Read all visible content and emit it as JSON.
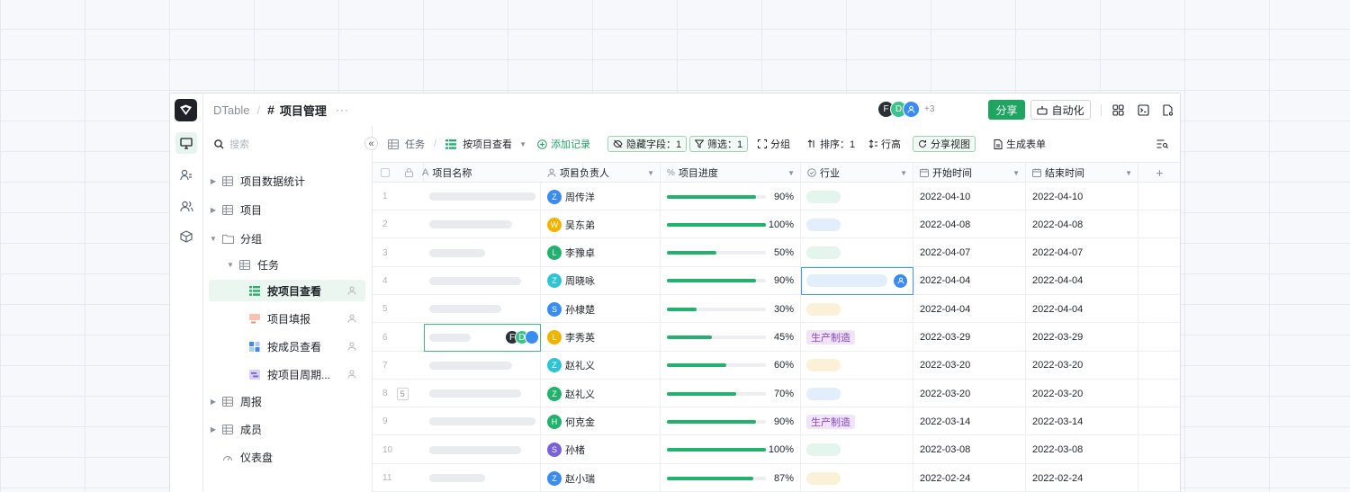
{
  "topbar": {
    "crumb": "DTable",
    "separator": "/",
    "hash": "#",
    "title": "项目管理",
    "more": "···",
    "avatars": [
      {
        "letter": "F",
        "color": "#2b2f36"
      },
      {
        "letter": "D",
        "color": "#3cc38a"
      },
      {
        "letter": "",
        "color": "#3a8cf2"
      }
    ],
    "extra_count": "+3",
    "share_label": "分享",
    "automation_label": "自动化"
  },
  "sidebar": {
    "search_placeholder": "搜索",
    "collapse_glyph": "«",
    "items": [
      {
        "label": "项目数据统计"
      },
      {
        "label": "项目"
      },
      {
        "label": "分组"
      },
      {
        "label": "任务"
      },
      {
        "label": "按项目查看"
      },
      {
        "label": "项目填报"
      },
      {
        "label": "按成员查看"
      },
      {
        "label": "按项目周期..."
      },
      {
        "label": "周报"
      },
      {
        "label": "成员"
      },
      {
        "label": "仪表盘"
      }
    ]
  },
  "viewbar": {
    "table": "任务",
    "slash": "/",
    "view": "按项目查看",
    "add_record": "添加记录",
    "hidden_fields": "隐藏字段：1",
    "filter": "筛选：1",
    "group": "分组",
    "sort": "排序：1",
    "row_height": "行高",
    "share_view": "分享视图",
    "gen_form": "生成表单"
  },
  "columns": [
    "项目名称",
    "项目负责人",
    "项目进度",
    "行业",
    "开始时间",
    "结束时间"
  ],
  "add_column": "+",
  "row_badge": "5",
  "collab_avatars": [
    {
      "letter": "F",
      "color": "#2b2f36"
    },
    {
      "letter": "D",
      "color": "#3cc38a"
    },
    {
      "letter": "",
      "color": "#3a8cf2"
    }
  ],
  "rows": [
    {
      "n": "1",
      "owner_initial": "Z",
      "owner": "周传洋",
      "owner_color": "#3a8cf2",
      "progress": 90,
      "progress_label": "90%",
      "industry": "",
      "industry_color": "#e3f5ec",
      "start": "2022-04-10",
      "end": "2022-04-10"
    },
    {
      "n": "2",
      "owner_initial": "W",
      "owner": "吴东弟",
      "owner_color": "#f0b400",
      "progress": 100,
      "progress_label": "100%",
      "industry": "",
      "industry_color": "#e3eefc",
      "start": "2022-04-08",
      "end": "2022-04-08"
    },
    {
      "n": "3",
      "owner_initial": "L",
      "owner": "李豫卓",
      "owner_color": "#23b26d",
      "progress": 50,
      "progress_label": "50%",
      "industry": "",
      "industry_color": "#e3f5ec",
      "start": "2022-04-07",
      "end": "2022-04-07"
    },
    {
      "n": "4",
      "owner_initial": "Z",
      "owner": "周晓咏",
      "owner_color": "#2ec4d6",
      "progress": 90,
      "progress_label": "90%",
      "industry": "",
      "industry_color": "#e3eefc",
      "start": "2022-04-04",
      "end": "2022-04-04"
    },
    {
      "n": "5",
      "owner_initial": "S",
      "owner": "孙棣楚",
      "owner_color": "#3a8cf2",
      "progress": 30,
      "progress_label": "30%",
      "industry": "",
      "industry_color": "#fbf1d9",
      "start": "2022-04-04",
      "end": "2022-04-04"
    },
    {
      "n": "6",
      "owner_initial": "L",
      "owner": "李秀英",
      "owner_color": "#f0b400",
      "progress": 45,
      "progress_label": "45%",
      "industry": "生产制造",
      "industry_color": "#efe4f8",
      "start": "2022-03-29",
      "end": "2022-03-29"
    },
    {
      "n": "7",
      "owner_initial": "Z",
      "owner": "赵礼义",
      "owner_color": "#2ec4d6",
      "progress": 60,
      "progress_label": "60%",
      "industry": "",
      "industry_color": "#fbf1d9",
      "start": "2022-03-20",
      "end": "2022-03-20"
    },
    {
      "n": "8",
      "owner_initial": "Z",
      "owner": "赵礼义",
      "owner_color": "#23b26d",
      "progress": 70,
      "progress_label": "70%",
      "industry": "",
      "industry_color": "#e3eefc",
      "start": "2022-03-20",
      "end": "2022-03-20"
    },
    {
      "n": "9",
      "owner_initial": "H",
      "owner": "何克金",
      "owner_color": "#23b26d",
      "progress": 90,
      "progress_label": "90%",
      "industry": "生产制造",
      "industry_color": "#efe4f8",
      "start": "2022-03-14",
      "end": "2022-03-14"
    },
    {
      "n": "10",
      "owner_initial": "S",
      "owner": "孙楮",
      "owner_color": "#7b61d9",
      "progress": 100,
      "progress_label": "100%",
      "industry": "",
      "industry_color": "#e3f5ec",
      "start": "2022-03-08",
      "end": "2022-03-08"
    },
    {
      "n": "11",
      "owner_initial": "Z",
      "owner": "赵小瑞",
      "owner_color": "#3a8cf2",
      "progress": 87,
      "progress_label": "87%",
      "industry": "",
      "industry_color": "#fbf1d9",
      "start": "2022-02-24",
      "end": "2022-02-24"
    }
  ]
}
